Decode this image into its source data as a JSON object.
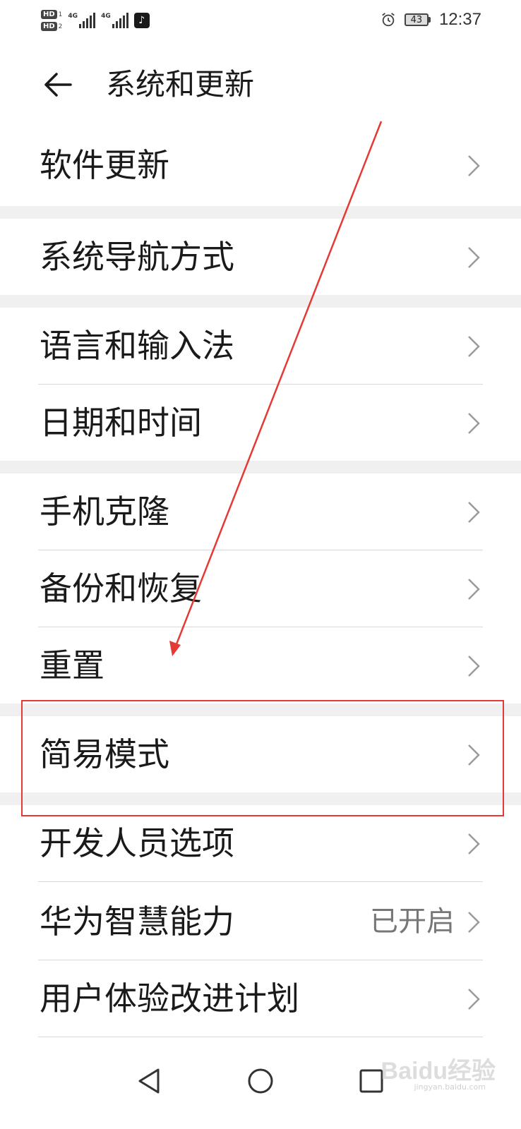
{
  "status_bar": {
    "hd1": "HD",
    "hd1_num": "1",
    "hd2": "HD",
    "hd2_num": "2",
    "sig1_gen": "4G",
    "sig2_gen": "4G",
    "battery": "43",
    "time": "12:37",
    "app_icon": "tiktok-icon",
    "alarm_icon": "alarm-icon"
  },
  "header": {
    "back_icon": "back-arrow-icon",
    "title": "系统和更新"
  },
  "items": [
    {
      "label": "软件更新",
      "value": ""
    },
    {
      "label": "系统导航方式",
      "value": ""
    },
    {
      "label": "语言和输入法",
      "value": ""
    },
    {
      "label": "日期和时间",
      "value": ""
    },
    {
      "label": "手机克隆",
      "value": ""
    },
    {
      "label": "备份和恢复",
      "value": ""
    },
    {
      "label": "重置",
      "value": ""
    },
    {
      "label": "简易模式",
      "value": ""
    },
    {
      "label": "开发人员选项",
      "value": ""
    },
    {
      "label": "华为智慧能力",
      "value": "已开启"
    },
    {
      "label": "用户体验改进计划",
      "value": ""
    }
  ],
  "annotation": {
    "color": "#e53935",
    "highlighted_item": "简易模式"
  },
  "nav_bar": {
    "back_icon": "nav-back-icon",
    "home_icon": "nav-home-icon",
    "recents_icon": "nav-recents-icon"
  },
  "watermark": {
    "text": "Baidu经验",
    "sub": "jingyan.baidu.com"
  }
}
